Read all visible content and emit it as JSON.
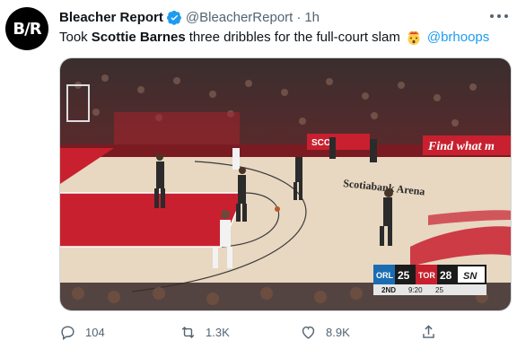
{
  "tweet": {
    "author_name": "Bleacher Report",
    "handle": "@BleacherReport",
    "separator": "·",
    "time": "1h",
    "avatar_text": "B/R",
    "text_prefix": "Took",
    "text_bold": "Scottie Barnes",
    "text_suffix": "three dribbles for the full-court slam",
    "mention": "@brhoops",
    "emoji": "astonished-face-exploding-head"
  },
  "media": {
    "ad_board_1": "Find what m",
    "ad_board_2": "SCO",
    "court_logo": "Scotiabank Arena",
    "scoreboard": {
      "team1": "ORL",
      "score1": "25",
      "team2": "TOR",
      "score2": "28",
      "network": "SN",
      "period": "2ND",
      "clock": "9:20",
      "shot_clock": "25"
    }
  },
  "actions": {
    "replies": "104",
    "retweets": "1.3K",
    "likes": "8.9K"
  },
  "colors": {
    "link": "#1d9bf0",
    "muted": "#536471",
    "court_red": "#c8202f",
    "court_wood": "#e8d7c1"
  }
}
